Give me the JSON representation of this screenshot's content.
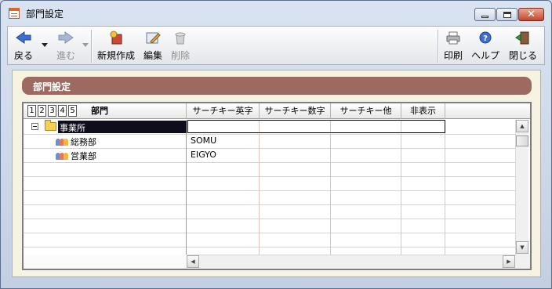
{
  "window": {
    "title": "部門設定"
  },
  "toolbar": {
    "back": "戻る",
    "forward": "進む",
    "new": "新規作成",
    "edit": "編集",
    "delete": "削除",
    "print": "印刷",
    "help": "ヘルプ",
    "close": "閉じる"
  },
  "section": {
    "title": "部門設定"
  },
  "grid": {
    "levels": [
      "1",
      "2",
      "3",
      "4",
      "5"
    ],
    "columns": [
      "部門",
      "サーチキー英字",
      "サーチキー数字",
      "サーチキー他",
      "非表示"
    ],
    "rows": [
      {
        "name": "事業所",
        "key_alpha": "",
        "key_num": "",
        "key_other": "",
        "hidden": ""
      },
      {
        "name": "総務部",
        "key_alpha": "SOMU",
        "key_num": "",
        "key_other": "",
        "hidden": ""
      },
      {
        "name": "営業部",
        "key_alpha": "EIGYO",
        "key_num": "",
        "key_other": "",
        "hidden": ""
      }
    ]
  },
  "colors": {
    "section_header": "#9c6a60",
    "selection": "#0d0d1d",
    "panel": "#f7f3e2"
  }
}
